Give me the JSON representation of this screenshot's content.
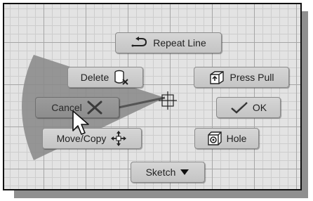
{
  "marking_menu": {
    "repeat_line": {
      "label": "Repeat Line",
      "icon": "repeat-line-icon"
    },
    "delete": {
      "label": "Delete",
      "icon": "delete-icon"
    },
    "press_pull": {
      "label": "Press Pull",
      "icon": "press-pull-icon"
    },
    "cancel": {
      "label": "Cancel",
      "icon": "cancel-x-icon"
    },
    "ok": {
      "label": "OK",
      "icon": "checkmark-icon"
    },
    "move_copy": {
      "label": "Move/Copy",
      "icon": "move-arrows-icon"
    },
    "hole": {
      "label": "Hole",
      "icon": "hole-icon"
    },
    "sketch": {
      "label": "Sketch",
      "icon": "dropdown-arrow-icon"
    }
  },
  "colors": {
    "grid_background": "#e3e3e3",
    "grid_major": "#a6a6a6",
    "grid_minor": "#cdcdcd",
    "highlight_wedge": "#8a8a8a",
    "button_face": "#cfcfcf"
  }
}
